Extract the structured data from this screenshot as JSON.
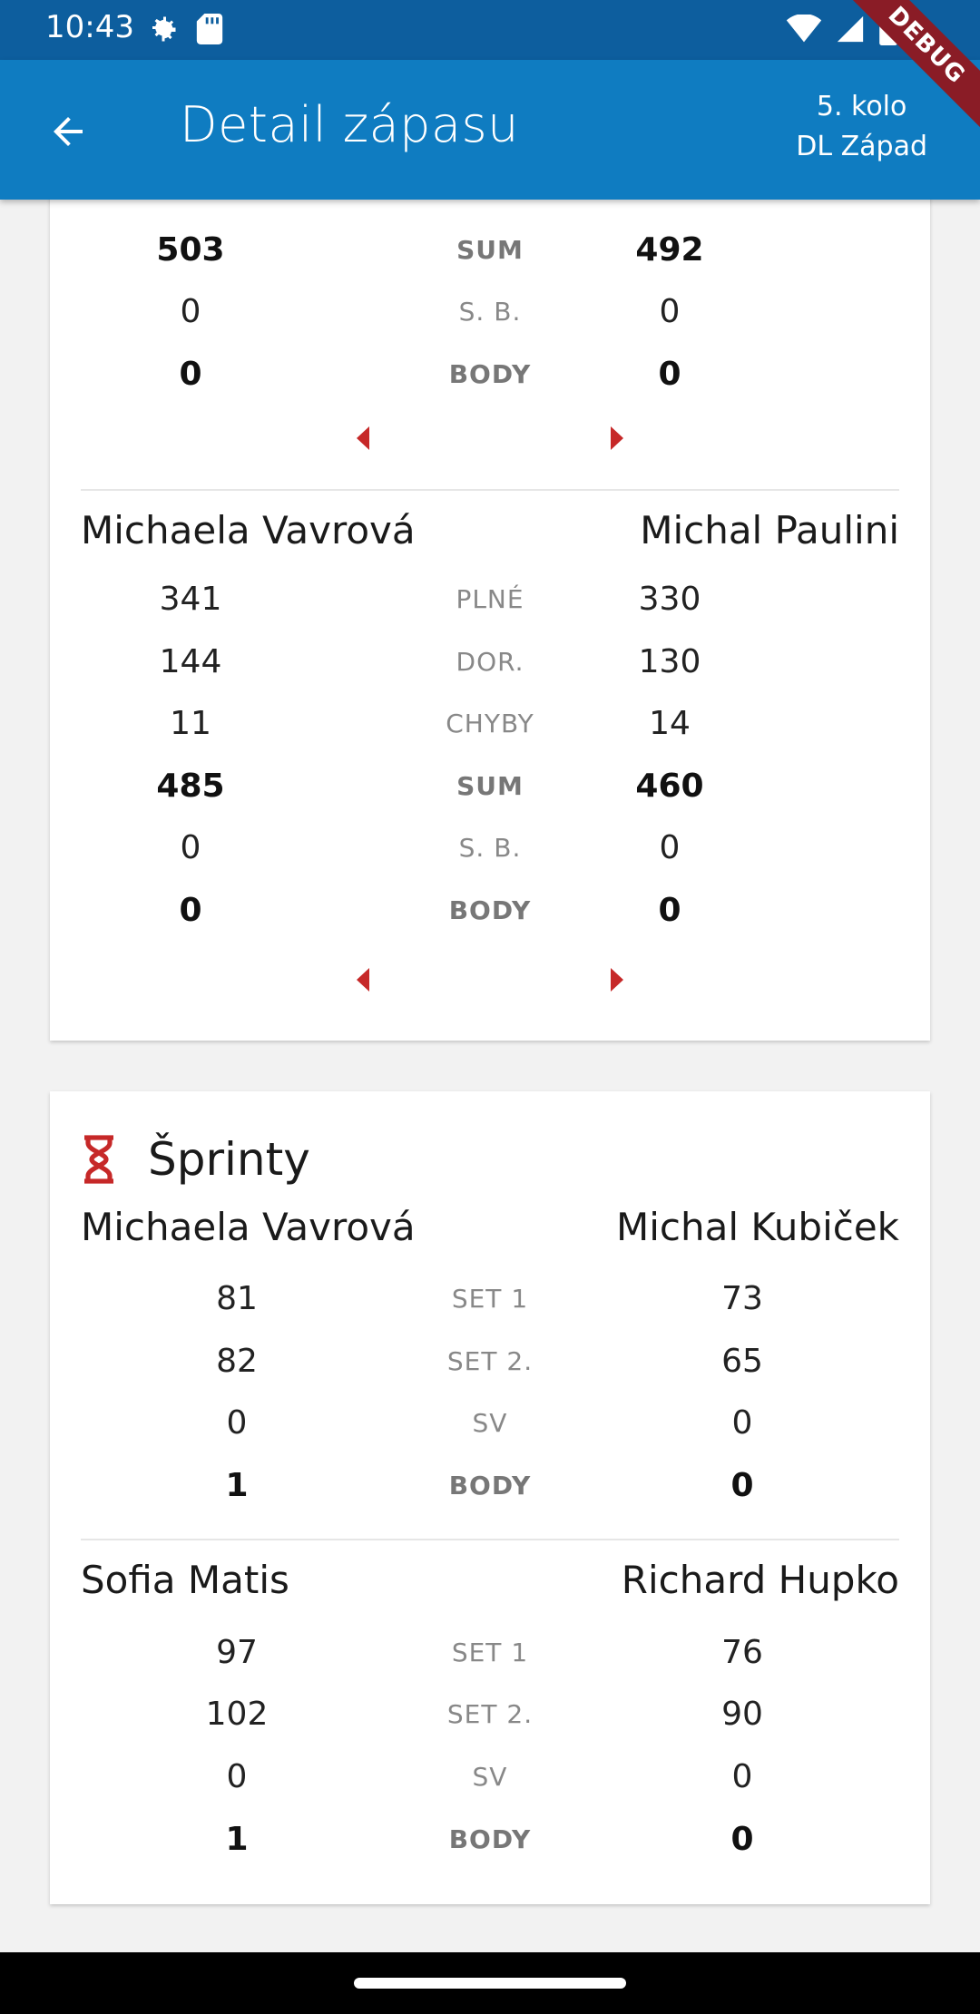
{
  "status": {
    "time": "10:43"
  },
  "appbar": {
    "title": "Detail zápasu",
    "round": "5. kolo",
    "league": "DL Západ",
    "debug": "DEBUG"
  },
  "card1": {
    "partial_rows": [
      {
        "label": "SUM",
        "left": "503",
        "right": "492",
        "bold": true
      },
      {
        "label": "S. B.",
        "left": "0",
        "right": "0",
        "bold": false
      },
      {
        "label": "BODY",
        "left": "0",
        "right": "0",
        "bold": true
      }
    ],
    "match2": {
      "left_player": "Michaela Vavrová",
      "right_player": "Michal Paulini",
      "rows": [
        {
          "label": "PLNÉ",
          "left": "341",
          "right": "330"
        },
        {
          "label": "DOR.",
          "left": "144",
          "right": "130"
        },
        {
          "label": "CHYBY",
          "left": "11",
          "right": "14"
        },
        {
          "label": "SUM",
          "left": "485",
          "right": "460"
        },
        {
          "label": "S. B.",
          "left": "0",
          "right": "0"
        },
        {
          "label": "BODY",
          "left": "0",
          "right": "0"
        }
      ]
    }
  },
  "sprints": {
    "title": "Šprinty",
    "matches": [
      {
        "left_player": "Michaela Vavrová",
        "right_player": "Michal Kubiček",
        "rows": [
          {
            "label": "SET 1",
            "left": "81",
            "right": "73"
          },
          {
            "label": "SET 2.",
            "left": "82",
            "right": "65"
          },
          {
            "label": "SV",
            "left": "0",
            "right": "0"
          },
          {
            "label": "BODY",
            "left": "1",
            "right": "0"
          }
        ]
      },
      {
        "left_player": "Sofia Matis",
        "right_player": "Richard Hupko",
        "rows": [
          {
            "label": "SET 1",
            "left": "97",
            "right": "76"
          },
          {
            "label": "SET 2.",
            "left": "102",
            "right": "90"
          },
          {
            "label": "SV",
            "left": "0",
            "right": "0"
          },
          {
            "label": "BODY",
            "left": "1",
            "right": "0"
          }
        ]
      }
    ]
  },
  "colors": {
    "appbar": "#0f7cc1",
    "statusbar": "#0d5e9e",
    "accent": "#c62828"
  },
  "icons": [
    "settings-icon",
    "sd-card-icon",
    "wifi-icon",
    "signal-icon",
    "battery-icon",
    "back-arrow-icon",
    "hourglass-icon",
    "arrow-left-icon",
    "arrow-right-icon"
  ]
}
